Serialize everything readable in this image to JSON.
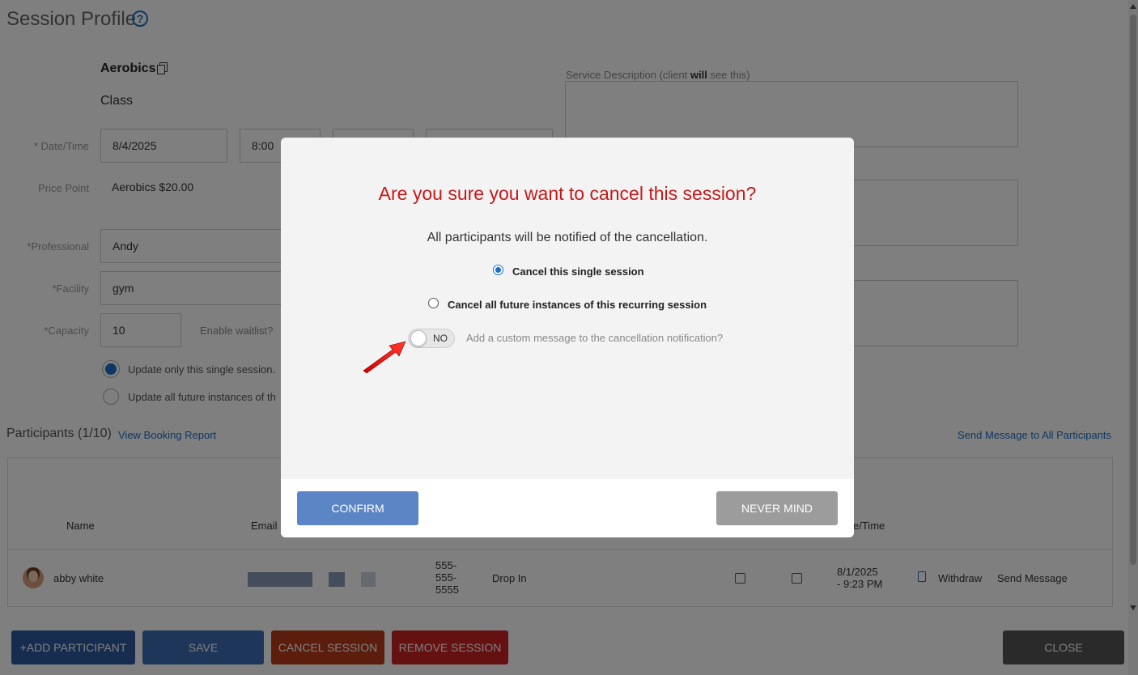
{
  "page": {
    "title": "Session Profile",
    "service_name": "Aerobics",
    "service_type": "Class"
  },
  "form": {
    "datetime_label": "* Date/Time",
    "date_value": "8/4/2025",
    "time_value": "8:00",
    "price_label": "Price Point",
    "price_value": "Aerobics $20.00",
    "professional_label": "*Professional",
    "professional_value": "Andy",
    "facility_label": "*Facility",
    "facility_value": "gym",
    "capacity_label": "*Capacity",
    "capacity_value": "10",
    "waitlist_label": "Enable waitlist?",
    "update_single_label": "Update only this single session.",
    "update_all_label": "Update all future instances of th"
  },
  "description": {
    "label_prefix": "Service Description (client ",
    "label_bold": "will",
    "label_suffix": " see this)"
  },
  "participants": {
    "title": "Participants (1/10)",
    "view_report_link": "View Booking Report",
    "send_all_link": "Send Message to All Participants",
    "headers": {
      "name": "Name",
      "email": "Email",
      "datetime": "e/Time"
    },
    "rows": [
      {
        "name": "abby white",
        "phone_1": "555-",
        "phone_2": "555-",
        "phone_3": "5555",
        "booking_type": "Drop In",
        "date_line1": "8/1/2025",
        "date_line2": "- 9:23 PM",
        "withdraw": "Withdraw",
        "send_message": "Send Message"
      }
    ]
  },
  "footer": {
    "add_participant": "+ADD PARTICIPANT",
    "save": "SAVE",
    "cancel_session": "CANCEL SESSION",
    "remove_session": "REMOVE SESSION",
    "close": "CLOSE"
  },
  "modal": {
    "title": "Are you sure you want to cancel this session?",
    "subtitle": "All participants will be notified of the cancellation.",
    "option_single": "Cancel this single session",
    "option_all": "Cancel all future instances of this recurring session",
    "selected_option": "single",
    "toggle_state": "NO",
    "toggle_label": "Add a custom message to the cancellation notification?",
    "confirm": "CONFIRM",
    "never_mind": "NEVER MIND"
  },
  "colors": {
    "accent": "#1a6fc9",
    "modal_title": "#c41a1a",
    "confirm": "#5b85c4",
    "never_mind": "#9c9c9c",
    "add_participant": "#2c5aa0",
    "save": "#3d6cb4",
    "cancel_session": "#b83a1a",
    "remove_session": "#cc2222",
    "close": "#555555"
  },
  "icons": {
    "help": "help-circle-icon",
    "copy": "copy-icon",
    "document": "document-icon",
    "annotation_arrow": "red-arrow-icon"
  }
}
